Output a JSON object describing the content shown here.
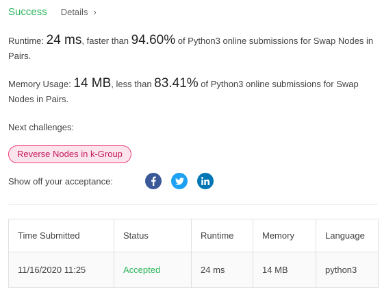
{
  "header": {
    "status": "Success",
    "details_label": "Details",
    "details_chevron": "›"
  },
  "runtime": {
    "label": "Runtime: ",
    "value": "24 ms",
    "mid": ", faster than ",
    "percent": "94.60%",
    "tail": " of Python3 online submissions for Swap Nodes in Pairs."
  },
  "memory": {
    "label": "Memory Usage: ",
    "value": "14 MB",
    "mid": ", less than ",
    "percent": "83.41%",
    "tail": " of Python3 online submissions for Swap Nodes in Pairs."
  },
  "next": {
    "label": "Next challenges:",
    "challenges": [
      "Reverse Nodes in k-Group"
    ]
  },
  "share": {
    "label": "Show off your acceptance:",
    "icons": [
      "facebook-icon",
      "twitter-icon",
      "linkedin-icon"
    ]
  },
  "table": {
    "headers": [
      "Time Submitted",
      "Status",
      "Runtime",
      "Memory",
      "Language"
    ],
    "rows": [
      [
        "11/16/2020 11:25",
        "Accepted",
        "24 ms",
        "14 MB",
        "python3"
      ]
    ]
  },
  "colors": {
    "success": "#2db55d",
    "pill_border": "#ec407a",
    "pill_bg": "#fce4ec",
    "facebook": "#3b5998",
    "twitter": "#1da1f2",
    "linkedin": "#0077b5"
  }
}
